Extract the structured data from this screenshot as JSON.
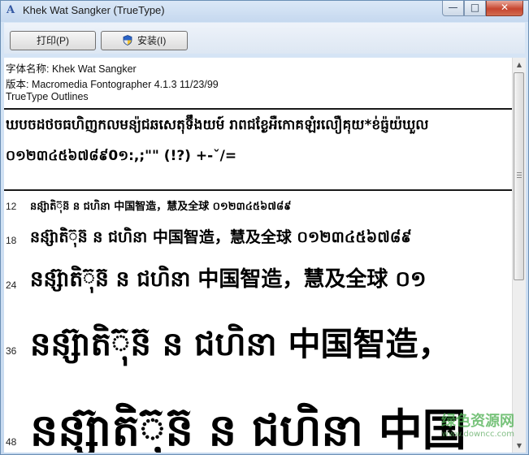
{
  "window": {
    "title": "Khek Wat Sangker (TrueType)",
    "controls": {
      "minimize": "—",
      "maximize": "□",
      "close": "✕"
    }
  },
  "toolbar": {
    "print_label": "打印(P)",
    "install_label": "安装(I)"
  },
  "font_info": {
    "name_line": "字体名称: Khek Wat Sangker",
    "version_line": "版本: Macromedia Fontographer 4.1.3 11/23/99",
    "type_line": "TrueType Outlines"
  },
  "charset": {
    "line1": "ឃបចដថចធហិញកលមន្យ៉ជឆសេតុទ៊ឹងយម៍ រាពជខ្ងែអឺកោគឡំរលឿគុយ*ខ់ធ្ញ៉យ៉ឃួល",
    "line2": "០១២៣៤៥៦៧៨៩0១:,;\"\" (!?) +-ˇ/="
  },
  "samples": [
    {
      "size": "12",
      "text": "នន្ស៊ាតិ៊ុន៊ ន ជហិនា 中国智造，慧及全球 ០១២៣៤៥៦៧៨៩"
    },
    {
      "size": "18",
      "text": "នន្ស៊ាតិ៊ុន៊ ន ជហិនា 中国智造，慧及全球 ០១២៣៤៥៦៧៨៩"
    },
    {
      "size": "24",
      "text": "នន្ស៊ាតិ៊ុន៊ ន ជហិនា 中国智造，慧及全球 ០១"
    },
    {
      "size": "36",
      "text": "នន្ស៊ាតិ៊ុន៊ ន ជហិនា 中国智造，"
    },
    {
      "size": "48",
      "text": "នន្ស៊ាតិ៊ុន៊ ន ជហិនា 中国"
    }
  ],
  "watermark": {
    "main": "绿色资源网",
    "sub": "www.downcc.com"
  }
}
